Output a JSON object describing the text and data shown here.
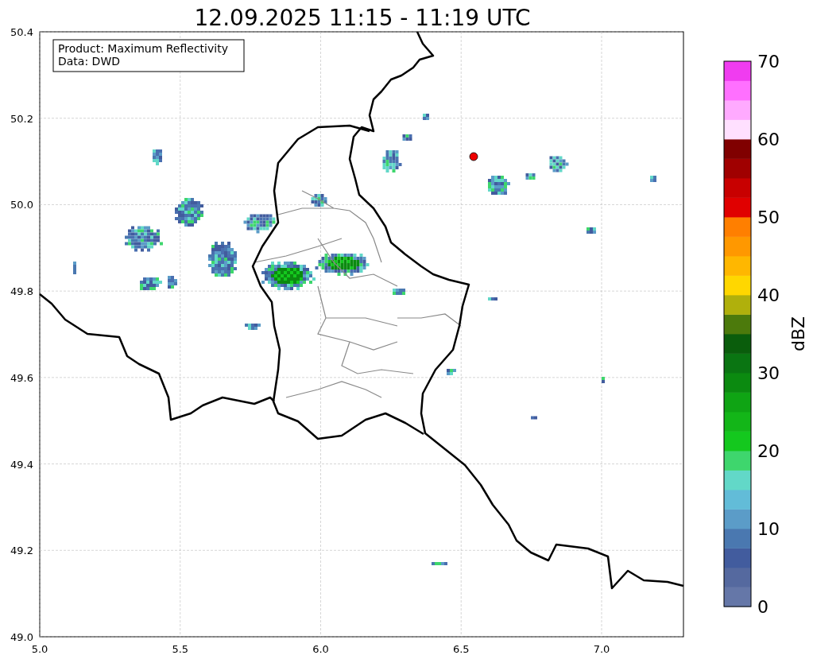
{
  "title": "12.09.2025 11:15 - 11:19 UTC",
  "info_box": {
    "lines": [
      "Product: Maximum Reflectivity",
      "Data: DWD"
    ]
  },
  "x_axis": {
    "ticks": [
      "5.0",
      "5.5",
      "6.0",
      "6.5",
      "7.0"
    ]
  },
  "y_axis": {
    "ticks": [
      "50.4",
      "50.2",
      "50.0",
      "49.8",
      "49.6",
      "49.4",
      "49.2",
      "49.0"
    ]
  },
  "colorbar": {
    "label": "dBZ",
    "ticks": [
      "70",
      "60",
      "50",
      "40",
      "30",
      "20",
      "10",
      "0"
    ],
    "segments": [
      {
        "color": "#6577a8"
      },
      {
        "color": "#55699f"
      },
      {
        "color": "#425c9e"
      },
      {
        "color": "#4a78b0"
      },
      {
        "color": "#5b9cc8"
      },
      {
        "color": "#62bcd8"
      },
      {
        "color": "#62d8c8"
      },
      {
        "color": "#3ed66d"
      },
      {
        "color": "#14c81e"
      },
      {
        "color": "#13b618"
      },
      {
        "color": "#0fa414"
      },
      {
        "color": "#0b8a10"
      },
      {
        "color": "#0a7512"
      },
      {
        "color": "#0a5d0c"
      },
      {
        "color": "#4c7a0c"
      },
      {
        "color": "#b0b00c"
      },
      {
        "color": "#ffd700"
      },
      {
        "color": "#ffb700"
      },
      {
        "color": "#ff9800"
      },
      {
        "color": "#ff7f00"
      },
      {
        "color": "#e00000"
      },
      {
        "color": "#c80000"
      },
      {
        "color": "#a00000"
      },
      {
        "color": "#800000"
      },
      {
        "color": "#ffe0ff"
      },
      {
        "color": "#ffaaff"
      },
      {
        "color": "#ff70ff"
      },
      {
        "color": "#f03cf0"
      }
    ]
  }
}
